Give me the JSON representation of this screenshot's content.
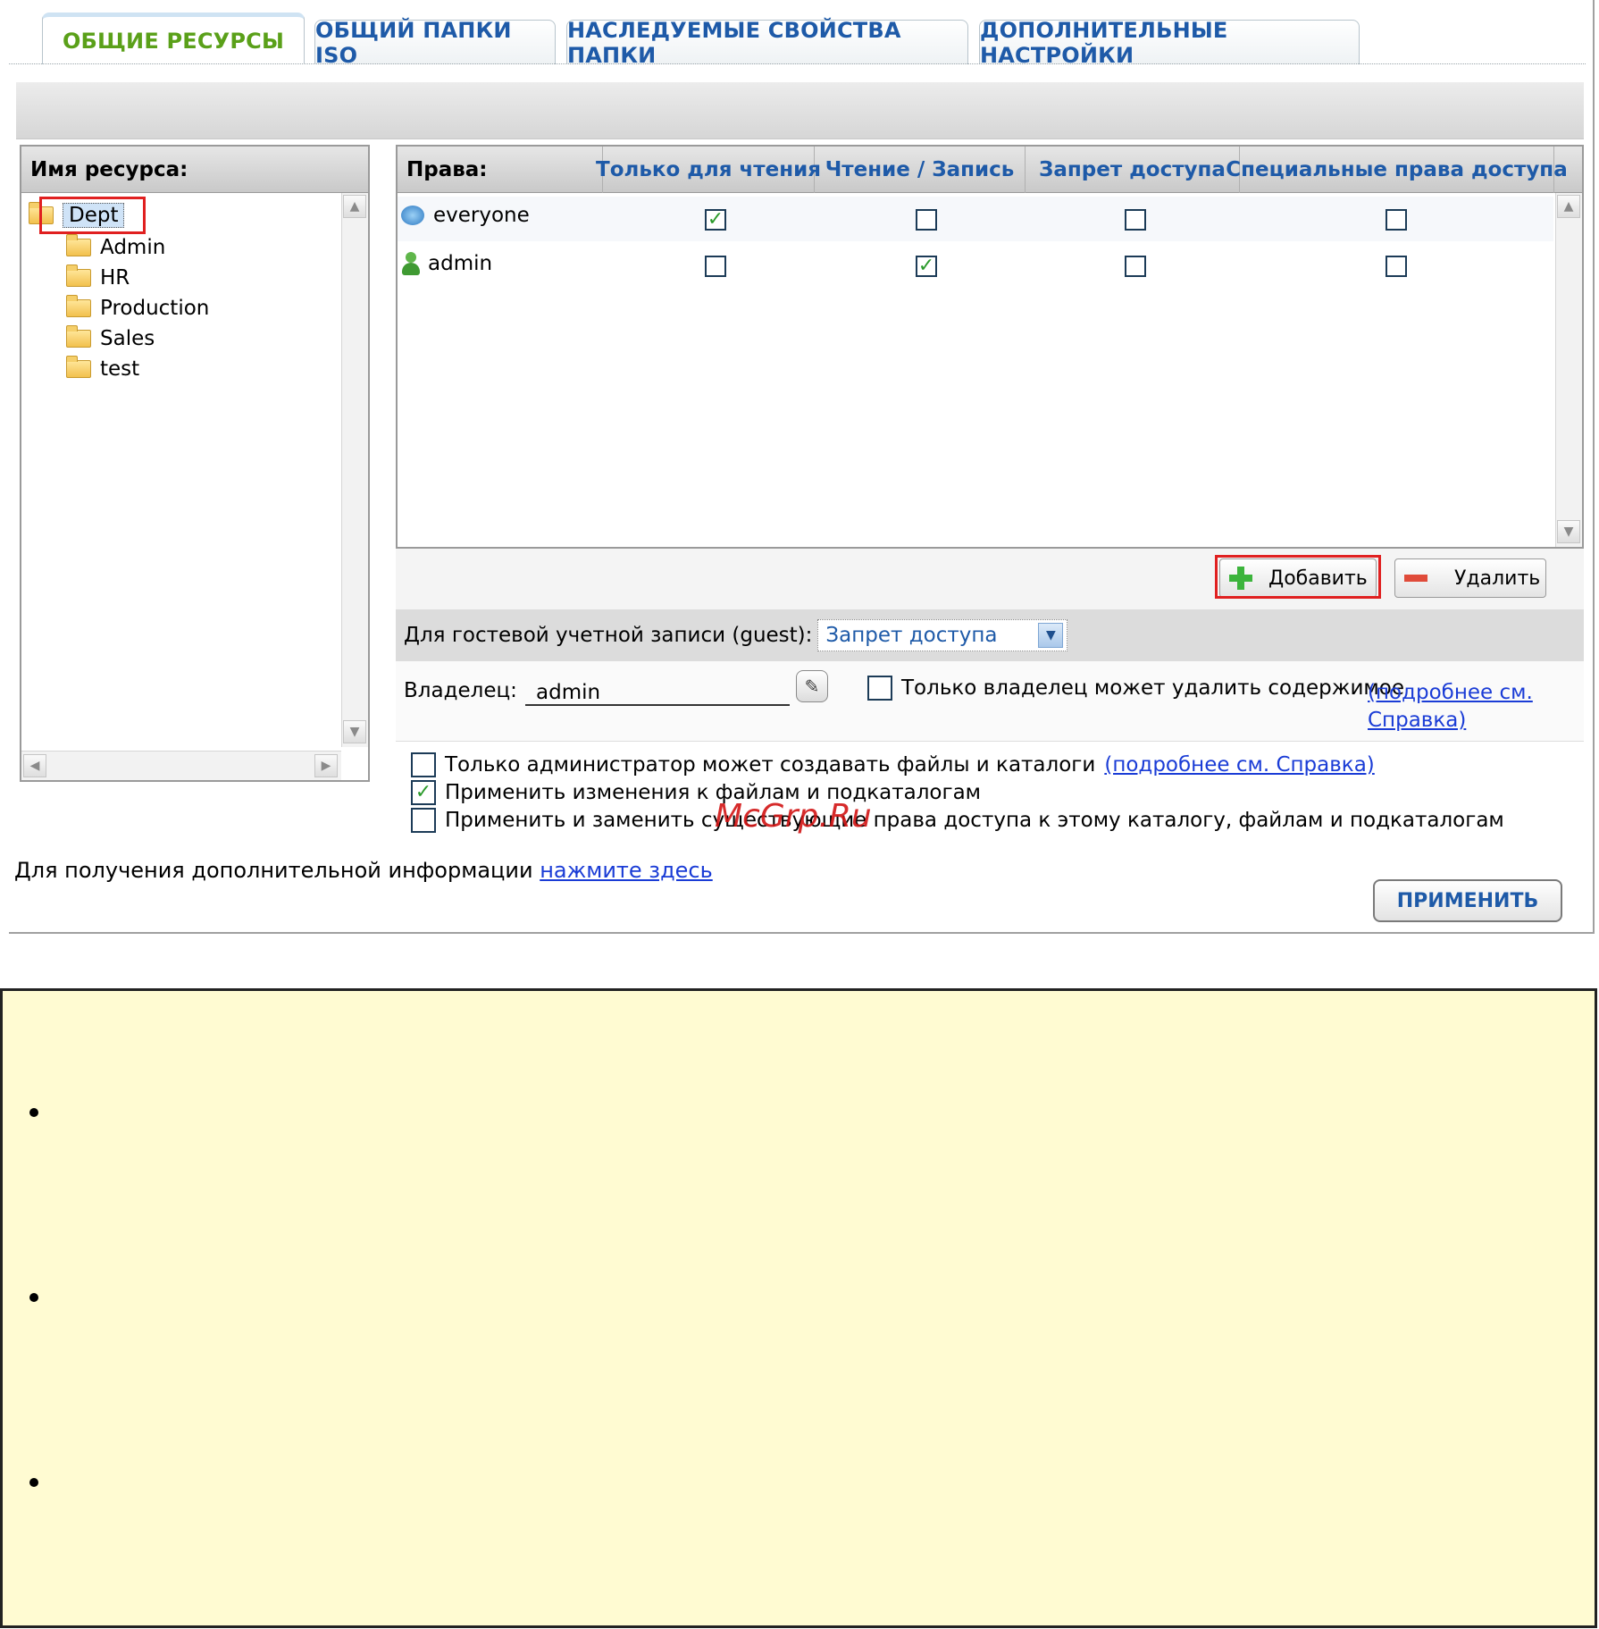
{
  "tabs": [
    {
      "label": "ОБЩИЕ РЕСУРСЫ",
      "active": true
    },
    {
      "label": "ОБЩИЙ ПАПКИ ISO",
      "active": false
    },
    {
      "label": "НАСЛЕДУЕМЫЕ СВОЙСТВА ПАПКИ",
      "active": false
    },
    {
      "label": "ДОПОЛНИТЕЛЬНЫЕ НАСТРОЙКИ",
      "active": false
    }
  ],
  "tree": {
    "header": "Имя ресурса:",
    "root": "Dept",
    "children": [
      "Admin",
      "HR",
      "Production",
      "Sales",
      "test"
    ]
  },
  "rights": {
    "header_label": "Права:",
    "columns": [
      "Только для чтения",
      "Чтение / Запись",
      "Запрет доступа",
      "Специальные права доступа"
    ],
    "rows": [
      {
        "name": "everyone",
        "icon": "group-icon",
        "checks": [
          true,
          false,
          false,
          false
        ]
      },
      {
        "name": "admin",
        "icon": "user-icon",
        "checks": [
          false,
          true,
          false,
          false
        ]
      }
    ]
  },
  "buttons": {
    "add": "Добавить",
    "remove": "Удалить",
    "apply": "ПРИМЕНИТЬ"
  },
  "guest": {
    "label": "Для гостевой учетной записи (guest):",
    "value": "Запрет доступа"
  },
  "owner": {
    "label": "Владелец:",
    "value": "admin",
    "only_owner_delete": "Только владелец может удалить содержимое",
    "only_owner_delete_checked": false,
    "help_link": "(подробнее см. Справка)"
  },
  "options": [
    {
      "text": "Только администратор может создавать файлы и каталоги",
      "checked": false,
      "link": "(подробнее см. Справка)"
    },
    {
      "text": "Применить изменения к файлам и подкаталогам",
      "checked": true,
      "link": ""
    },
    {
      "text": "Применить и заменить существующие права доступа к этому каталогу, файлам и подкаталогам",
      "checked": false,
      "link": ""
    }
  ],
  "info": {
    "text": "Для получения дополнительной информации",
    "link": "нажмите здесь"
  },
  "watermark": "McGrp.Ru",
  "colors": {
    "tab_active": "#5aa019",
    "link": "#1a3cd6",
    "accent_blue": "#1e5aa8",
    "highlight_red": "#e02020",
    "note_bg": "#fffbd2"
  }
}
